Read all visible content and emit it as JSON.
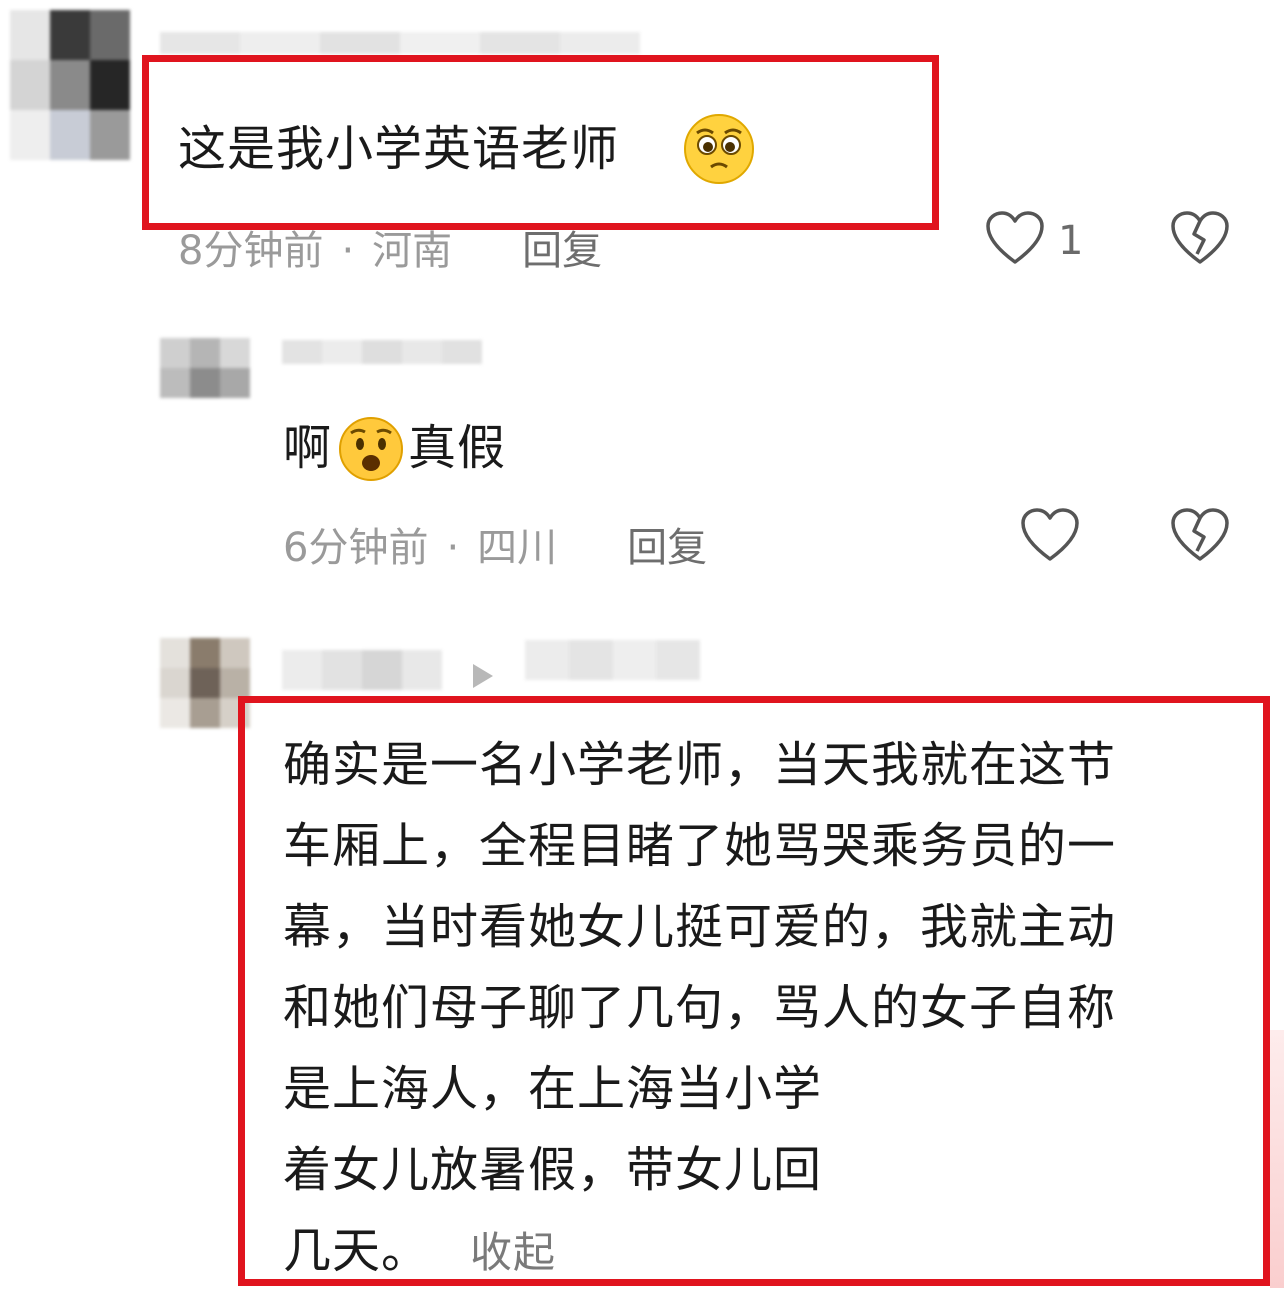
{
  "comments": [
    {
      "text": "这是我小学英语老师",
      "emoji_icon": "pleading-face-emoji",
      "time": "8分钟前",
      "location": "河南",
      "reply_label": "回复",
      "like_count": "1"
    },
    {
      "text_before": "啊",
      "emoji_icon": "anguished-face-emoji",
      "text_after": "真假",
      "time": "6分钟前",
      "location": "四川",
      "reply_label": "回复"
    },
    {
      "lines": [
        "确实是一名小学老师，当天我就在这节",
        "车厢上，全程目睹了她骂哭乘务员的一",
        "幕，当时看她女儿挺可爱的，我就主动",
        "和她们母子聊了几句，骂人的女子自称",
        "是上海人，在上海当小学",
        "着女儿放暑假，带女儿回",
        "几天。"
      ],
      "collapse_label": "收起"
    }
  ],
  "colors": {
    "highlight_border": "#e0141e",
    "meta_text": "#9a9a9a"
  },
  "icons": [
    "heart-outline-icon",
    "broken-heart-icon",
    "play-triangle-icon"
  ]
}
